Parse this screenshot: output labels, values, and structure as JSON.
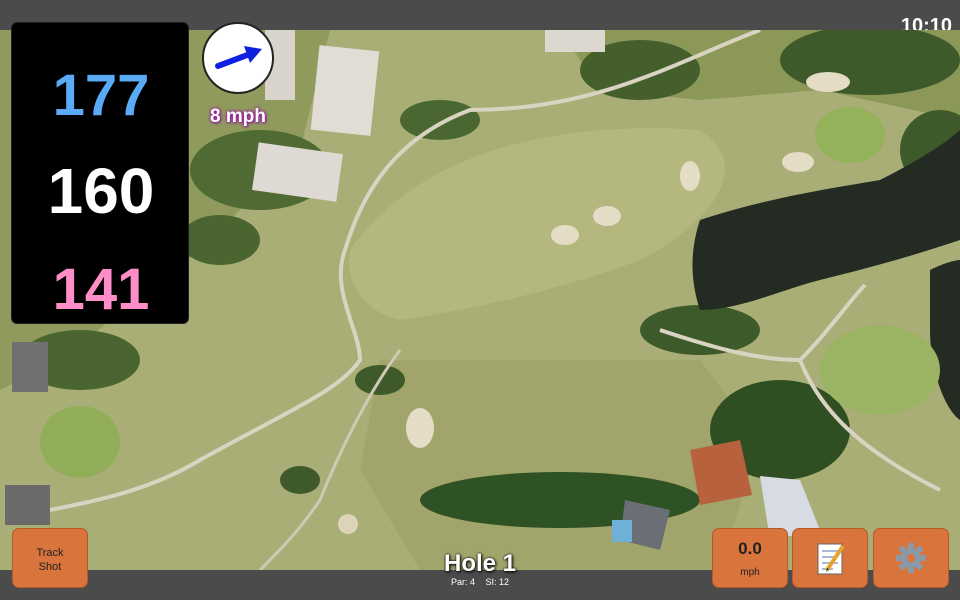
{
  "status_bar": {
    "time": "10:10"
  },
  "yardages": {
    "back": "177",
    "middle": "160",
    "front": "141"
  },
  "wind": {
    "speed_label": "8 mph",
    "icon": "wind-arrow-icon"
  },
  "buttons": {
    "track_shot_line1": "Track",
    "track_shot_line2": "Shot",
    "speed_value": "0.0",
    "speed_unit": "mph",
    "notes_icon": "notepad-icon",
    "settings_icon": "gear-icon"
  },
  "hole": {
    "title": "Hole 1",
    "par": "Par: 4",
    "stroke_index": "SI: 12"
  },
  "colors": {
    "button": "#d9743c",
    "back_yardage": "#5aaaf5",
    "front_yardage": "#ff8ec8",
    "wind_label_glow": "#a020a0"
  }
}
